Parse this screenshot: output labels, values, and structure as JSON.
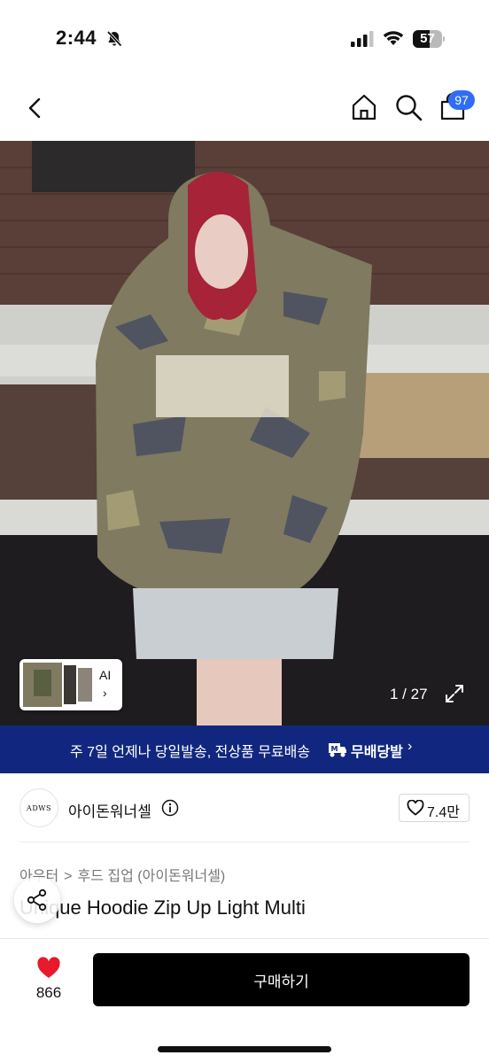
{
  "status_bar": {
    "time": "2:44",
    "battery_percent": "57",
    "battery_level": 0.57,
    "icons": [
      "bell-slash-icon",
      "cellular-signal-icon",
      "wifi-icon",
      "battery-icon"
    ]
  },
  "nav": {
    "icons": [
      "back-icon",
      "home-icon",
      "search-icon",
      "cart-icon"
    ],
    "cart_count": "97"
  },
  "product_image": {
    "counter": "1 / 27",
    "thumbnail_label": "AI",
    "thumbnail_arrow": "›",
    "icons": [
      "expand-icon"
    ]
  },
  "promo_banner": {
    "text": "주 7일 언제나 당일발송, 전상품 무료배송",
    "brand": "무배당발",
    "chevron": "›"
  },
  "seller": {
    "logo_text": "ADWS",
    "name": "아이돈워너셀",
    "like_count": "7.4만",
    "icons": [
      "info-icon",
      "heart-outline-icon"
    ]
  },
  "product": {
    "breadcrumb": [
      "아우터",
      "후드 집업 (아이돈워너셀)"
    ],
    "breadcrumb_separator": ">",
    "title": "Unique Hoodie Zip Up Light Multi"
  },
  "bottom_bar": {
    "wish_count": "866",
    "buy_label": "구매하기",
    "icons": [
      "heart-filled-icon",
      "share-icon"
    ]
  },
  "colors": {
    "banner_bg": "#11277f",
    "badge_bg": "#2f6df6",
    "heart_red": "#e8192c",
    "buy_button_bg": "#000000"
  }
}
